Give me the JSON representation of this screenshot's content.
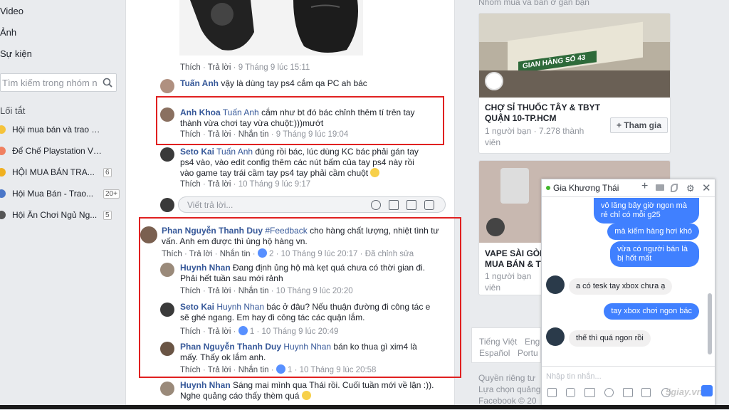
{
  "left_nav": {
    "items": [
      "Video",
      "Ảnh",
      "Sự kiện"
    ],
    "search_placeholder": "Tìm kiếm trong nhóm n",
    "shortcuts_title": "Lối tắt",
    "shortcuts": [
      {
        "label": "Hội mua bán và trao đổi...",
        "badge": ""
      },
      {
        "label": "Để Chế Playstation Viet...",
        "badge": ""
      },
      {
        "label": "HỘI MUA BÁN TRA...",
        "badge": "6"
      },
      {
        "label": "Hội Mua Bán - Trao...",
        "badge": "20+"
      },
      {
        "label": "Hội Ăn Chơi Ngủ Ng...",
        "badge": "5"
      }
    ]
  },
  "feed": {
    "top_actions": {
      "like": "Thích",
      "reply": "Trả lời",
      "time": "9 Tháng 9 lúc 15:11"
    },
    "c1": {
      "name": "Tuấn Anh",
      "text": "vậy là dùng tay ps4 cắm qa PC ah bác"
    },
    "c2": {
      "name": "Anh Khoa",
      "tag": "Tuấn Anh",
      "text": "cắm như bt đó bác chỉnh thêm tí trên tay thành vừa chơi tay vừa chuột:)))mướt",
      "like": "Thích",
      "reply": "Trả lời",
      "msg": "Nhắn tin",
      "time": "9 Tháng 9 lúc 19:04"
    },
    "c3": {
      "name": "Seto Kai",
      "tag": "Tuấn Anh",
      "text": "đúng rồi bác, lúc dùng KC bác phải gán tay ps4 vào, vào edit config thêm các nút bấm của tay ps4 này rồi vào game tay trái cầm tay ps4 tay phải cầm chuột",
      "like": "Thích",
      "reply": "Trả lời",
      "time": "10 Tháng 9 lúc 9:17"
    },
    "reply_placeholder": "Viết trả lời...",
    "c4": {
      "name": "Phan Nguyễn Thanh Duy",
      "tag": "#Feedback",
      "text": "cho hàng chất lượng, nhiệt tình tư vấn. Anh em được thì ủng hộ hàng vn.",
      "like": "Thích",
      "reply": "Trả lời",
      "msg": "Nhắn tin",
      "likes": "2",
      "time": "10 Tháng 9 lúc 20:17",
      "edited": "Đã chỉnh sửa"
    },
    "c5": {
      "name": "Huynh Nhan",
      "text": "Đang định ủng hộ mà kẹt quá chưa có thời gian đi. Phải hết tuần sau mới rảnh",
      "like": "Thích",
      "reply": "Trả lời",
      "msg": "Nhắn tin",
      "time": "10 Tháng 9 lúc 20:20"
    },
    "c6": {
      "name": "Seto Kai",
      "tag": "Huynh Nhan",
      "text": "bác ở đâu? Nếu thuận đường đi công tác e sẽ ghé ngang. Em hay đi công tác các quận lắm.",
      "like": "Thích",
      "reply": "Trả lời",
      "likes": "1",
      "time": "10 Tháng 9 lúc 20:49"
    },
    "c7": {
      "name": "Phan Nguyễn Thanh Duy",
      "tag": "Huynh Nhan",
      "text": "bán ko thua gì xim4 là mấy. Thấy ok lắm anh.",
      "like": "Thích",
      "reply": "Trả lời",
      "msg": "Nhắn tin",
      "likes": "1",
      "time": "10 Tháng 9 lúc 20:58"
    },
    "c8": {
      "name": "Huynh Nhan",
      "text": "Sáng mai mình qua Thái rồi. Cuối tuần mới về lận :)). Nghe quảng cáo thấy thèm quá"
    }
  },
  "right": {
    "header": "Nhóm mua và bán ở gần bạn",
    "group1": {
      "sign": "CHỢ SỈ THUỐC TÂY & TBYT QUẬN 10-TP.HCM",
      "name": "CHỢ SỈ THUỐC TÂY & TBYT QUẬN 10-TP.HCM",
      "meta": "1 người bạn · 7.278 thành viên",
      "join": "+ Tham gia",
      "photo_sign": "GIAN HÀNG SỐ 43"
    },
    "group2": {
      "name": "VAPE SÀI GÒN MUA BÁN & T",
      "meta": "1 người bạn",
      "meta2": "viên"
    },
    "langs": [
      "Tiếng Việt",
      "Eng",
      "Español",
      "Portu"
    ],
    "footer": [
      "Quyền riêng tư",
      "Lựa chọn quảng",
      "Facebook © 20"
    ]
  },
  "chat": {
    "name": "Gia Khương Thái",
    "messages": [
      {
        "from": "me",
        "text": "vô lăng bây giờ ngon mà rẻ chỉ có mỗi g25"
      },
      {
        "from": "me",
        "text": "mà kiếm hàng hơi khó"
      },
      {
        "from": "me",
        "text": "vừa có người bán là bị hốt mất"
      },
      {
        "from": "other",
        "text": "a có tesk tay xbox chưa ạ"
      },
      {
        "from": "me",
        "text": "tay xbox chơi ngon bác"
      },
      {
        "from": "other",
        "text": "thế thì quá ngon rồi"
      }
    ],
    "input_placeholder": "Nhập tin nhắn...",
    "watermark": "5giay.vn"
  },
  "colors": {
    "accent": "#4080ff",
    "link": "#365899",
    "highlight": "#e02020"
  }
}
